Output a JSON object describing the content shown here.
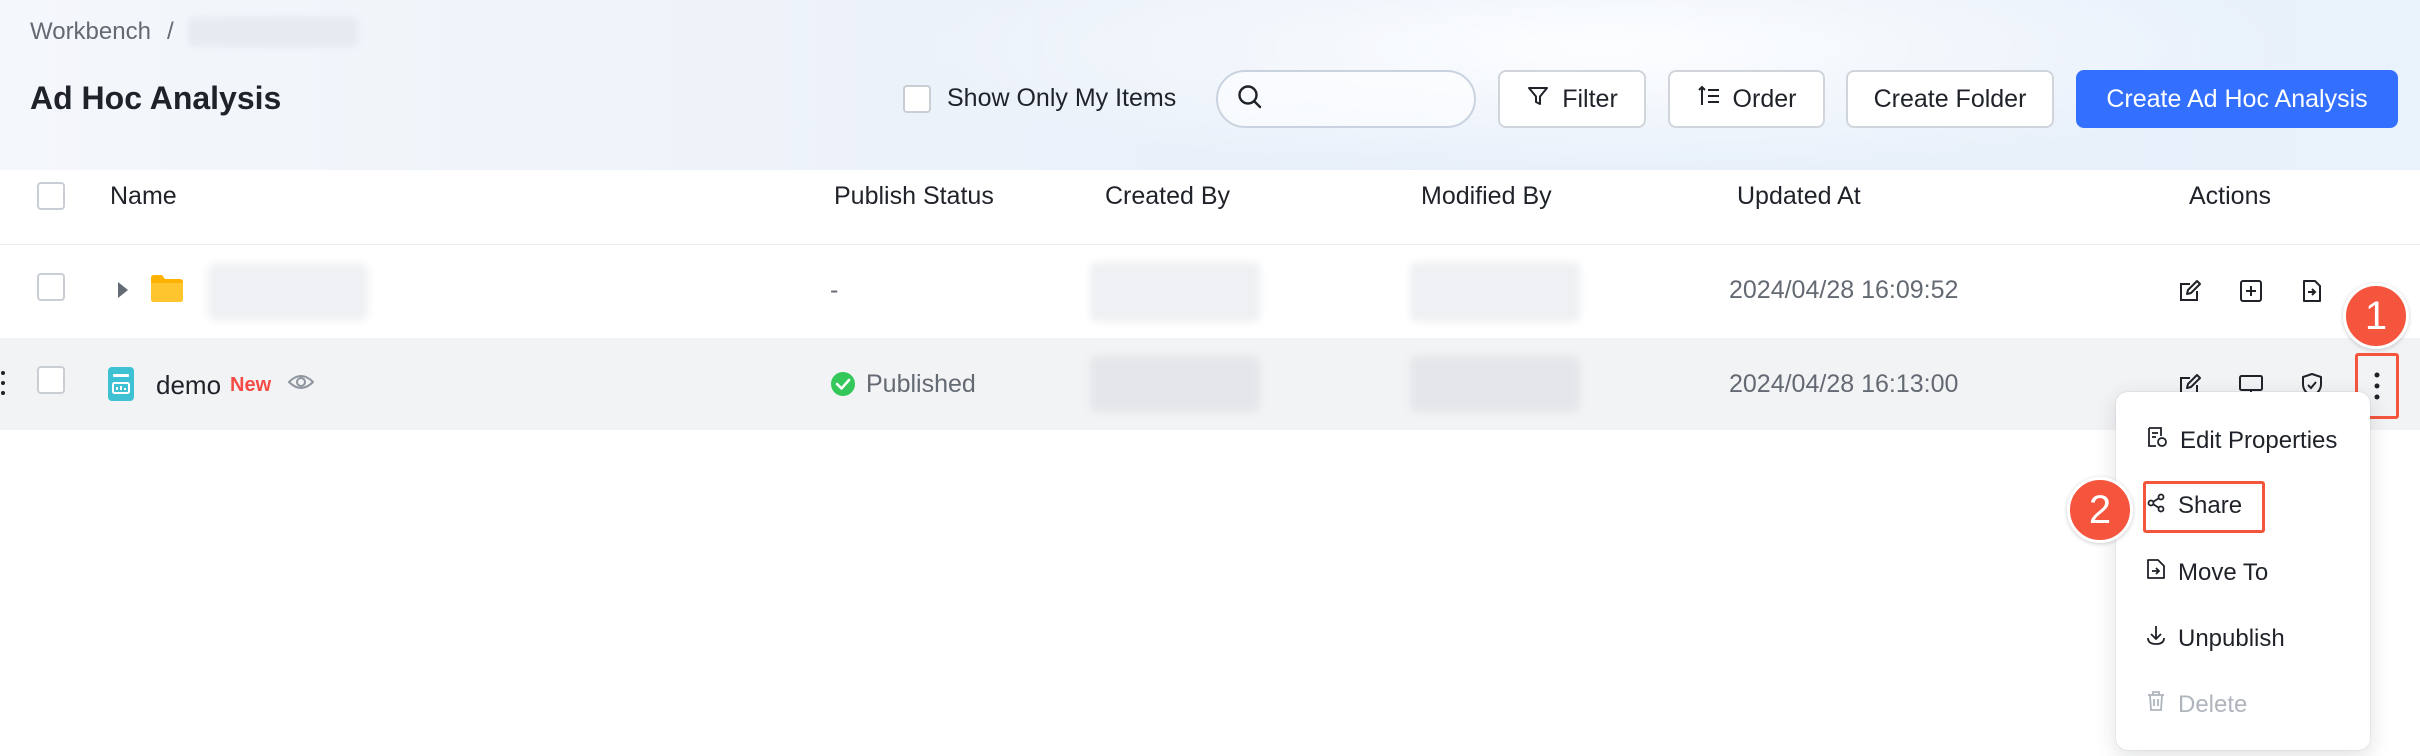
{
  "breadcrumb": {
    "root": "Workbench",
    "separator": "/"
  },
  "page": {
    "title": "Ad Hoc Analysis"
  },
  "toolbar": {
    "show_only_label": "Show Only My Items",
    "search_placeholder": "",
    "filter_label": "Filter",
    "order_label": "Order",
    "create_folder_label": "Create Folder",
    "create_analysis_label": "Create Ad Hoc Analysis"
  },
  "table": {
    "columns": [
      "Name",
      "Publish Status",
      "Created By",
      "Modified By",
      "Updated At",
      "Actions"
    ],
    "rows": [
      {
        "type": "folder",
        "publish_status": "-",
        "updated_at": "2024/04/28 16:09:52"
      },
      {
        "type": "file",
        "name": "demo",
        "badge": "New",
        "publish_status": "Published",
        "updated_at": "2024/04/28 16:13:00"
      }
    ]
  },
  "annotations": {
    "step1": "1",
    "step2": "2"
  },
  "menu": {
    "items": [
      "Edit Properties",
      "Share",
      "Move To",
      "Unpublish",
      "Delete"
    ]
  },
  "colors": {
    "primary": "#3370ff",
    "accent_red": "#f5553d",
    "success": "#34c759",
    "folder": "#ffb300",
    "file_icon": "#3ec1d3",
    "badge_red": "#f54a45"
  }
}
